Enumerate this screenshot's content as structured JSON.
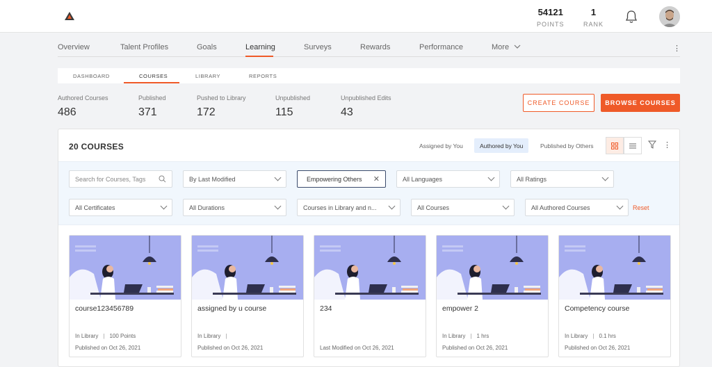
{
  "header": {
    "points_value": "54121",
    "points_label": "POINTS",
    "rank_value": "1",
    "rank_label": "RANK",
    "icons": [
      "logo-icon",
      "bell-icon",
      "avatar"
    ]
  },
  "main_nav": {
    "items": [
      "Overview",
      "Talent Profiles",
      "Goals",
      "Learning",
      "Surveys",
      "Rewards",
      "Performance",
      "More"
    ],
    "active": "Learning"
  },
  "sub_tabs": {
    "items": [
      "DASHBOARD",
      "COURSES",
      "LIBRARY",
      "REPORTS"
    ],
    "active": "COURSES"
  },
  "stats": [
    {
      "label": "Authored Courses",
      "value": "486"
    },
    {
      "label": "Published",
      "value": "371"
    },
    {
      "label": "Pushed to Library",
      "value": "172"
    },
    {
      "label": "Unpublished",
      "value": "115"
    },
    {
      "label": "Unpublished Edits",
      "value": "43"
    }
  ],
  "actions": {
    "create": "CREATE COURSE",
    "browse": "BROWSE COURSES",
    "accent": "#ef5a28"
  },
  "panel": {
    "title": "20 COURSES",
    "tabs": [
      "Assigned by You",
      "Authored by You",
      "Published by Others"
    ],
    "active_tab": "Authored by You"
  },
  "filters": {
    "search_placeholder": "Search for Courses, Tags",
    "sort": "By Last Modified",
    "tag": "Empowering Others",
    "language": "All Languages",
    "ratings": "All Ratings",
    "certificates": "All Certificates",
    "durations": "All Durations",
    "library": "Courses in Library and n...",
    "courses": "All Courses",
    "authored": "All Authored Courses",
    "reset": "Reset"
  },
  "cards": [
    {
      "title": "course123456789",
      "meta1a": "In Library",
      "meta1b": "100 Points",
      "meta2": "Published on Oct 26, 2021"
    },
    {
      "title": "assigned by u course",
      "meta1a": "In Library",
      "meta1b": "",
      "meta2": "Published on Oct 26, 2021"
    },
    {
      "title": "234",
      "meta1a": "",
      "meta1b": "",
      "meta2": "Last Modified on Oct 26, 2021"
    },
    {
      "title": "empower 2",
      "meta1a": "In Library",
      "meta1b": "1 hrs",
      "meta2": "Published on Oct 26, 2021"
    },
    {
      "title": "Competency course",
      "meta1a": "In Library",
      "meta1b": "0.1 hrs",
      "meta2": "Published on Oct 26, 2021"
    }
  ]
}
